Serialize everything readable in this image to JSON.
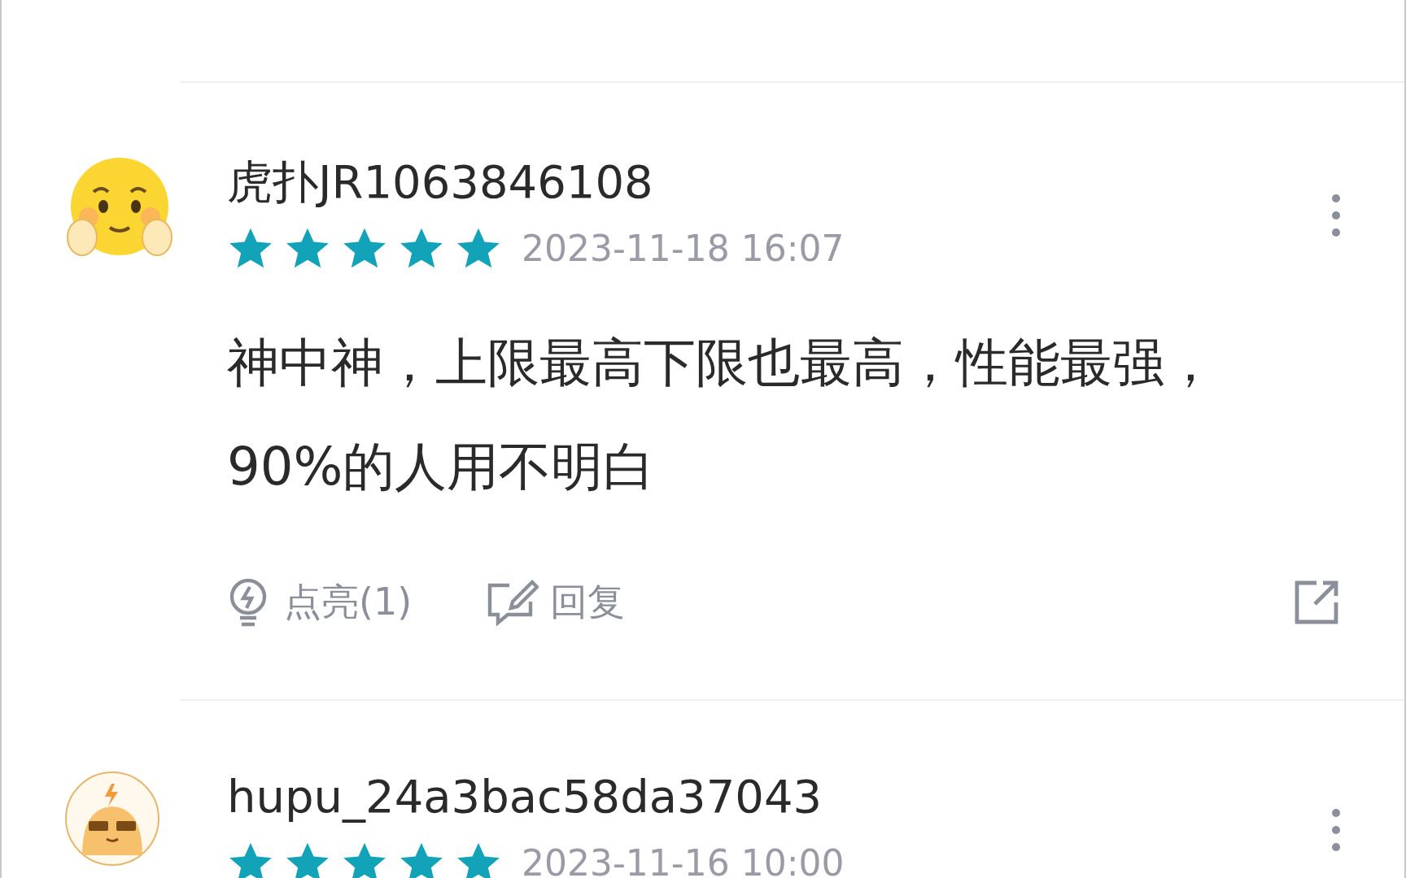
{
  "comments": [
    {
      "avatar": {
        "kind": "emoji"
      },
      "name": "虎扑JR1063846108",
      "stars": 5,
      "date": "2023-11-18 16:07",
      "text": "神中神，上限最高下限也最高，性能最强，90%的人用不明白",
      "like_label": "点亮(1)",
      "reply_label": "回复"
    },
    {
      "avatar": {
        "kind": "robot"
      },
      "name": "hupu_24a3bac58da37043",
      "stars": 5,
      "date": "2023-11-16 10:00"
    }
  ]
}
